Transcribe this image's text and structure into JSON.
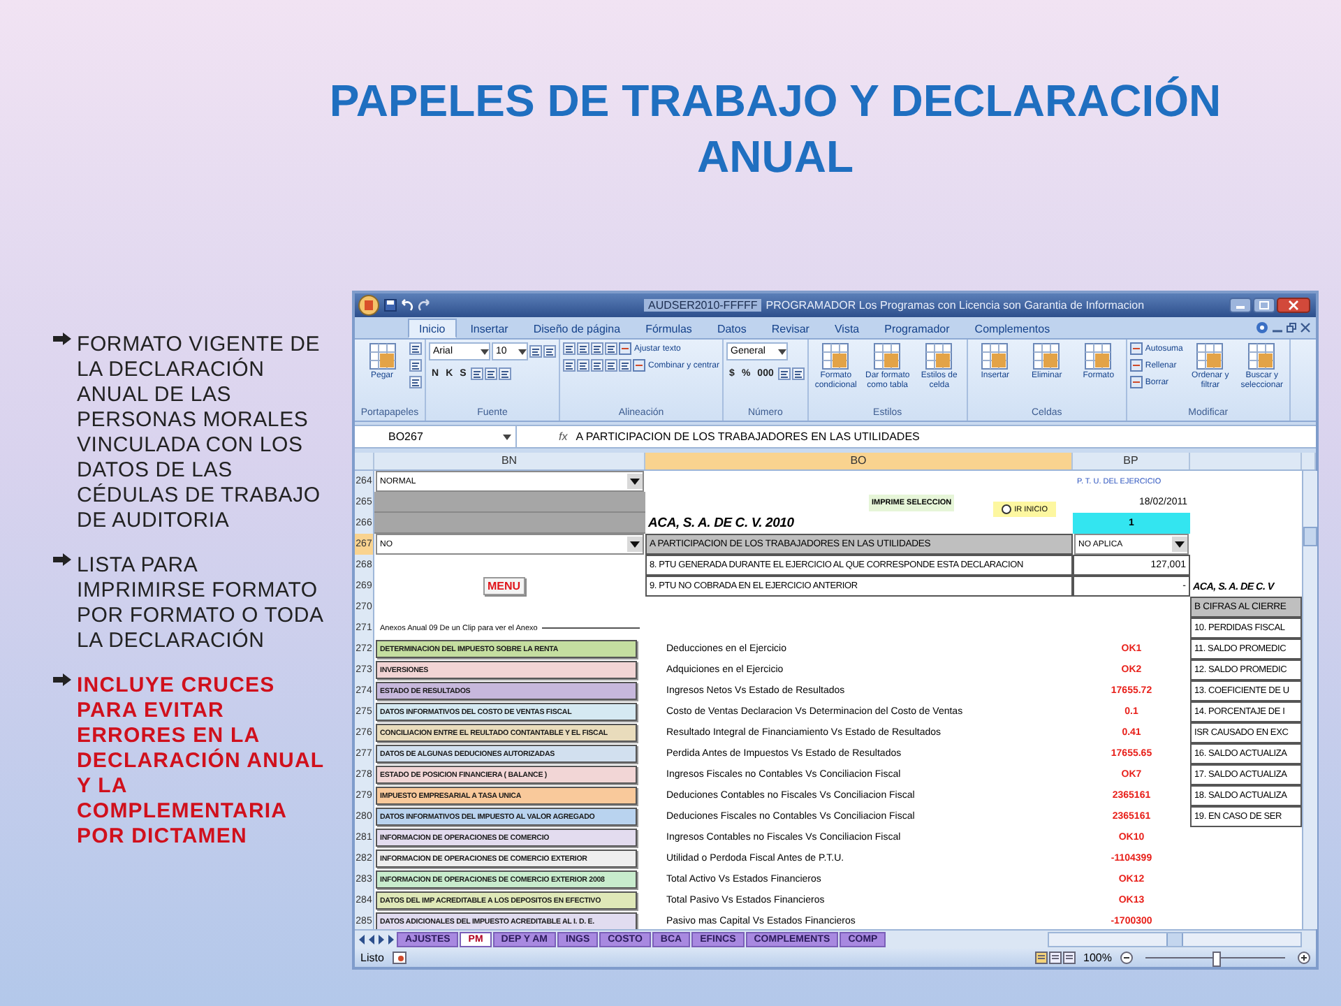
{
  "slide": {
    "title": "PAPELES DE TRABAJO Y DECLARACIÓN ANUAL",
    "bullets": [
      {
        "text": "FORMATO VIGENTE DE LA DECLARACIÓN ANUAL DE LAS PERSONAS MORALES VINCULADA CON LOS DATOS DE LAS CÉDULAS DE TRABAJO DE AUDITORIA",
        "emphasis": false
      },
      {
        "text": "LISTA PARA IMPRIMIRSE FORMATO POR FORMATO O TODA LA DECLARACIÓN",
        "emphasis": false
      },
      {
        "text": "INCLUYE CRUCES PARA EVITAR ERRORES EN LA DECLARACIÓN ANUAL Y LA COMPLEMENTARIA POR DICTAMEN",
        "emphasis": true
      }
    ]
  },
  "window": {
    "file_name": "AUDSER2010-FFFFF",
    "title": "PROGRAMADOR Los Programas con Licencia son Garantia de Informacion"
  },
  "tabs": [
    {
      "label": "Inicio",
      "selected": true
    },
    {
      "label": "Insertar",
      "selected": false
    },
    {
      "label": "Diseño de página",
      "selected": false
    },
    {
      "label": "Fórmulas",
      "selected": false
    },
    {
      "label": "Datos",
      "selected": false
    },
    {
      "label": "Revisar",
      "selected": false
    },
    {
      "label": "Vista",
      "selected": false
    },
    {
      "label": "Programador",
      "selected": false
    },
    {
      "label": "Complementos",
      "selected": false
    }
  ],
  "ribbon": [
    {
      "label": "Portapapeles",
      "items": [
        {
          "kind": "large",
          "text": "Pegar"
        },
        {
          "kind": "stack",
          "items": [
            {
              "kind": "icon"
            },
            {
              "kind": "icon"
            },
            {
              "kind": "icon"
            }
          ]
        }
      ]
    },
    {
      "label": "Fuente",
      "items": [
        {
          "kind": "stack",
          "items": [
            {
              "kind": "line",
              "items": [
                {
                  "kind": "field",
                  "text": "Arial"
                },
                {
                  "kind": "field",
                  "text": "10"
                },
                {
                  "kind": "icon"
                },
                {
                  "kind": "icon"
                }
              ]
            },
            {
              "kind": "line",
              "items": [
                {
                  "kind": "button",
                  "text": "N"
                },
                {
                  "kind": "button",
                  "text": "K"
                },
                {
                  "kind": "button",
                  "text": "S"
                },
                {
                  "kind": "icon"
                },
                {
                  "kind": "icon"
                },
                {
                  "kind": "icon"
                }
              ]
            }
          ]
        }
      ]
    },
    {
      "label": "Alineación",
      "items": [
        {
          "kind": "stack",
          "items": [
            {
              "kind": "line",
              "items": [
                {
                  "kind": "icon"
                },
                {
                  "kind": "icon"
                },
                {
                  "kind": "icon"
                },
                {
                  "kind": "icon"
                },
                {
                  "kind": "small",
                  "text": "Ajustar texto"
                }
              ]
            },
            {
              "kind": "line",
              "items": [
                {
                  "kind": "icon"
                },
                {
                  "kind": "icon"
                },
                {
                  "kind": "icon"
                },
                {
                  "kind": "icon"
                },
                {
                  "kind": "icon"
                },
                {
                  "kind": "small",
                  "text": "Combinar y centrar"
                }
              ]
            }
          ]
        }
      ]
    },
    {
      "label": "Número",
      "items": [
        {
          "kind": "stack",
          "items": [
            {
              "kind": "line",
              "items": [
                {
                  "kind": "field",
                  "text": "General"
                }
              ]
            },
            {
              "kind": "line",
              "items": [
                {
                  "kind": "button",
                  "text": "$"
                },
                {
                  "kind": "button",
                  "text": "%"
                },
                {
                  "kind": "button",
                  "text": "000"
                },
                {
                  "kind": "icon"
                },
                {
                  "kind": "icon"
                }
              ]
            }
          ]
        }
      ]
    },
    {
      "label": "Estilos",
      "items": [
        {
          "kind": "large",
          "text": "Formato condicional"
        },
        {
          "kind": "large",
          "text": "Dar formato como tabla"
        },
        {
          "kind": "large",
          "text": "Estilos de celda"
        }
      ]
    },
    {
      "label": "Celdas",
      "items": [
        {
          "kind": "large",
          "text": "Insertar"
        },
        {
          "kind": "large",
          "text": "Eliminar"
        },
        {
          "kind": "large",
          "text": "Formato"
        }
      ]
    },
    {
      "label": "Modificar",
      "items": [
        {
          "kind": "stack",
          "items": [
            {
              "kind": "small",
              "text": "Autosuma"
            },
            {
              "kind": "small",
              "text": "Rellenar"
            },
            {
              "kind": "small",
              "text": "Borrar"
            }
          ]
        },
        {
          "kind": "large",
          "text": "Ordenar y filtrar"
        },
        {
          "kind": "large",
          "text": "Buscar y seleccionar"
        }
      ]
    }
  ],
  "formula_bar": {
    "cell": "BO267",
    "function_label": "fx",
    "value": "A PARTICIPACION DE LOS TRABAJADORES EN LAS UTILIDADES"
  },
  "columns": [
    {
      "label": "BN",
      "selected": false
    },
    {
      "label": "BO",
      "selected": true
    },
    {
      "label": "BP",
      "selected": false
    }
  ],
  "rows": [
    {
      "number": "264",
      "selected": false,
      "bn": {
        "kind": "dropdown",
        "text": "NORMAL"
      },
      "bp": {
        "kind": "note",
        "text": "P. T. U. DEL EJERCICIO"
      }
    },
    {
      "number": "265",
      "selected": false,
      "bn": {
        "kind": "shaded"
      },
      "bo": {
        "kind": "buttons",
        "buttons": [
          {
            "kind": "print",
            "text": "IMPRIME SELECCION"
          },
          {
            "kind": "radio",
            "text": "IR INICIO",
            "selected": false
          }
        ]
      },
      "bp": {
        "kind": "number",
        "text": "18/02/2011"
      }
    },
    {
      "number": "266",
      "selected": false,
      "bn": {
        "kind": "shaded"
      },
      "bo": {
        "kind": "title",
        "text": "ACA, S. A. DE C. V. 2010"
      },
      "bp": {
        "kind": "highlight",
        "text": "1"
      }
    },
    {
      "number": "267",
      "selected": true,
      "bn": {
        "kind": "dropdown",
        "text": "NO"
      },
      "bo": {
        "kind": "heading",
        "text": "A PARTICIPACION DE LOS TRABAJADORES EN LAS UTILIDADES"
      },
      "bp": {
        "kind": "dropdown",
        "text": "NO APLICA"
      }
    },
    {
      "number": "268",
      "selected": false,
      "bo": {
        "kind": "boxed",
        "text": "8. PTU GENERADA DURANTE EL EJERCICIO AL QUE CORRESPONDE ESTA DECLARACION"
      },
      "bp": {
        "kind": "boxed_number",
        "text": "127,001"
      }
    },
    {
      "number": "269",
      "selected": false,
      "bn": {
        "kind": "menu",
        "text": "MENU"
      },
      "bo": {
        "kind": "boxed",
        "text": "9. PTU NO COBRADA EN EL EJERCICIO ANTERIOR"
      },
      "bp": {
        "kind": "boxed_number",
        "text": "-"
      },
      "col_4": {
        "kind": "title",
        "text": "ACA, S. A. DE C. V"
      }
    },
    {
      "number": "270",
      "selected": false,
      "col_4": {
        "kind": "heading",
        "text": "B CIFRAS AL CIERRE"
      }
    },
    {
      "number": "271",
      "selected": false,
      "bn": {
        "kind": "group_label",
        "text": "Anexos Anual  09 De un Clip para ver el Anexo"
      },
      "col_4": {
        "kind": "boxed",
        "text": "10. PERDIDAS FISCAL"
      }
    },
    {
      "number": "272",
      "selected": false,
      "bn": {
        "kind": "annex",
        "text": "DETERMINACION DEL IMPUESTO SOBRE LA RENTA",
        "color": "#c5dea0"
      },
      "bo": {
        "kind": "label",
        "text": "Deducciones en el Ejercicio"
      },
      "bp": {
        "kind": "result",
        "text": "OK1"
      },
      "col_4": {
        "kind": "boxed",
        "text": "11. SALDO PROMEDIC"
      }
    },
    {
      "number": "273",
      "selected": false,
      "bn": {
        "kind": "annex",
        "text": "INVERSIONES",
        "color": "#f2d4d4"
      },
      "bo": {
        "kind": "label",
        "text": "Adquiciones en el Ejercicio"
      },
      "bp": {
        "kind": "result",
        "text": "OK2"
      },
      "col_4": {
        "kind": "boxed",
        "text": "12. SALDO PROMEDIC"
      }
    },
    {
      "number": "274",
      "selected": false,
      "bn": {
        "kind": "annex",
        "text": "ESTADO DE RESULTADOS",
        "color": "#c7b8dc"
      },
      "bo": {
        "kind": "label",
        "text": "Ingresos Netos Vs Estado de Resultados"
      },
      "bp": {
        "kind": "result",
        "text": "17655.72"
      },
      "col_4": {
        "kind": "boxed",
        "text": "13. COEFICIENTE DE U"
      }
    },
    {
      "number": "275",
      "selected": false,
      "bn": {
        "kind": "annex",
        "text": "DATOS INFORMATIVOS DEL COSTO DE VENTAS FISCAL",
        "color": "#d5e9f2"
      },
      "bo": {
        "kind": "label",
        "text": "Costo de Ventas Declaracion Vs Determinacion del Costo de Ventas"
      },
      "bp": {
        "kind": "result",
        "text": "0.1"
      },
      "col_4": {
        "kind": "boxed",
        "text": "14. PORCENTAJE DE I"
      }
    },
    {
      "number": "276",
      "selected": false,
      "bn": {
        "kind": "annex",
        "text": "CONCILIACION ENTRE EL REULTADO CONTANTABLE Y EL FISCAL",
        "color": "#e9dcbc"
      },
      "bo": {
        "kind": "label",
        "text": "Resultado Integral de Financiamiento Vs Estado de Resultados"
      },
      "bp": {
        "kind": "result",
        "text": "0.41"
      },
      "col_4": {
        "kind": "boxed",
        "text": "ISR CAUSADO EN EXC"
      }
    },
    {
      "number": "277",
      "selected": false,
      "bn": {
        "kind": "annex",
        "text": "DATOS DE ALGUNAS DEDUCIONES AUTORIZADAS",
        "color": "#d2e0ef"
      },
      "bo": {
        "kind": "label",
        "text": "Perdida Antes de Impuestos Vs Estado de Resultados"
      },
      "bp": {
        "kind": "result",
        "text": "17655.65"
      },
      "col_4": {
        "kind": "boxed",
        "text": "16. SALDO ACTUALIZA"
      }
    },
    {
      "number": "278",
      "selected": false,
      "bn": {
        "kind": "annex",
        "text": "ESTADO DE POSICION FINANCIERA ( BALANCE )",
        "color": "#f2d6d6"
      },
      "bo": {
        "kind": "label",
        "text": "Ingresos Fiscales  no Contables Vs Conciliacion Fiscal"
      },
      "bp": {
        "kind": "result",
        "text": "OK7"
      },
      "col_4": {
        "kind": "boxed",
        "text": "17. SALDO ACTUALIZA"
      }
    },
    {
      "number": "279",
      "selected": false,
      "bn": {
        "kind": "annex",
        "text": "IMPUESTO EMPRESARIAL A TASA UNICA",
        "color": "#f9c99b"
      },
      "bo": {
        "kind": "label",
        "text": "Deduciones Contables no Fiscales Vs Conciliacion Fiscal"
      },
      "bp": {
        "kind": "result",
        "text": "2365161"
      },
      "col_4": {
        "kind": "boxed",
        "text": "18. SALDO ACTUALIZA"
      }
    },
    {
      "number": "280",
      "selected": false,
      "bn": {
        "kind": "annex",
        "text": "DATOS INFORMATIVOS DEL IMPUESTO AL VALOR AGREGADO",
        "color": "#b9d3ef"
      },
      "bo": {
        "kind": "label",
        "text": "Deduciones Fiscales no Contables Vs Conciliacion Fiscal"
      },
      "bp": {
        "kind": "result",
        "text": "2365161"
      },
      "col_4": {
        "kind": "boxed",
        "text": "19. EN CASO DE SER"
      }
    },
    {
      "number": "281",
      "selected": false,
      "bn": {
        "kind": "annex",
        "text": "INFORMACION DE OPERACIONES DE COMERCIO",
        "color": "#e3dcef"
      },
      "bo": {
        "kind": "label",
        "text": "Ingresos Contables no Fiscales Vs Conciliacion Fiscal"
      },
      "bp": {
        "kind": "result",
        "text": "OK10"
      }
    },
    {
      "number": "282",
      "selected": false,
      "bn": {
        "kind": "annex",
        "text": "INFORMACION DE OPERACIONES DE COMERCIO EXTERIOR",
        "color": "#eeeeee"
      },
      "bo": {
        "kind": "label",
        "text": "Utilidad o Perdoda Fiscal Antes de P.T.U."
      },
      "bp": {
        "kind": "result",
        "text": "-1104399"
      }
    },
    {
      "number": "283",
      "selected": false,
      "bn": {
        "kind": "annex",
        "text": "INFORMACION DE OPERACIONES DE COMERCIO EXTERIOR 2008",
        "color": "#c8eccd"
      },
      "bo": {
        "kind": "label",
        "text": "Total Activo Vs Estados Financieros"
      },
      "bp": {
        "kind": "result",
        "text": "OK12"
      }
    },
    {
      "number": "284",
      "selected": false,
      "bn": {
        "kind": "annex",
        "text": "DATOS DEL IMP ACREDITABLE A LOS DEPOSITOS EN EFECTIVO",
        "color": "#dfe8b8"
      },
      "bo": {
        "kind": "label",
        "text": "Total Pasivo Vs Estados Financieros"
      },
      "bp": {
        "kind": "result",
        "text": "OK13"
      }
    },
    {
      "number": "285",
      "selected": false,
      "bn": {
        "kind": "annex",
        "text": "DATOS ADICIONALES DEL IMPUESTO ACREDITABLE AL I. D. E.",
        "color": "#e1dcf0"
      },
      "bo": {
        "kind": "label",
        "text": "Pasivo mas Capital Vs Estados Financieros"
      },
      "bp": {
        "kind": "result",
        "text": "-1700300"
      }
    }
  ],
  "sheet_tabs": [
    {
      "label": "AJUSTES",
      "selected": false
    },
    {
      "label": "PM",
      "selected": true
    },
    {
      "label": "DEP Y AM",
      "selected": false
    },
    {
      "label": "INGS",
      "selected": false
    },
    {
      "label": "COSTO",
      "selected": false
    },
    {
      "label": "BCA",
      "selected": false
    },
    {
      "label": "EFINCS",
      "selected": false
    },
    {
      "label": "COMPLEMENTS",
      "selected": false
    },
    {
      "label": "COMP",
      "selected": false
    }
  ],
  "status_bar": {
    "text": "Listo",
    "zoom": "100%",
    "zoom_slider": {
      "level": 0.5
    }
  }
}
